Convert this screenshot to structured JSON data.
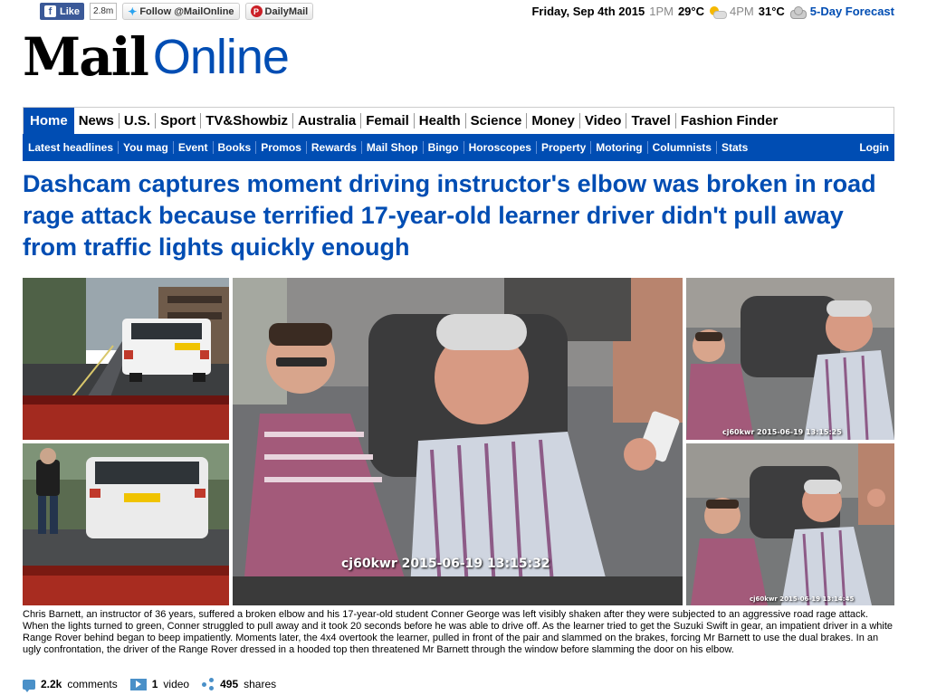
{
  "social": {
    "facebook_label": "Like",
    "facebook_count": "2.8m",
    "twitter_label": "Follow @MailOnline",
    "pinterest_label": "DailyMail"
  },
  "weather": {
    "date": "Friday, Sep 4th 2015",
    "time1": "1PM",
    "temp1": "29°C",
    "time2": "4PM",
    "temp2": "31°C",
    "forecast_link": "5-Day Forecast",
    "icon1": "sun-cloud-icon",
    "icon2": "cloud-icon"
  },
  "logo": {
    "part1": "Mail",
    "part2": "Online"
  },
  "main_nav": [
    "Home",
    "News",
    "U.S.",
    "Sport",
    "TV&Showbiz",
    "Australia",
    "Femail",
    "Health",
    "Science",
    "Money",
    "Video",
    "Travel",
    "Fashion Finder"
  ],
  "sub_nav": [
    "Latest headlines",
    "You mag",
    "Event",
    "Books",
    "Promos",
    "Rewards",
    "Mail Shop",
    "Bingo",
    "Horoscopes",
    "Property",
    "Motoring",
    "Columnists",
    "Stats"
  ],
  "login_label": "Login",
  "article": {
    "headline": "Dashcam captures moment driving instructor's elbow was broken in road rage attack because terrified 17-year-old learner driver didn't pull away from traffic lights quickly enough",
    "caption": "Chris Barnett, an instructor of 36 years, suffered a broken elbow and his 17-year-old student Conner George was left visibly shaken after they were subjected to an aggressive road rage attack. When the lights turned to green, Conner struggled to pull away and it took 20 seconds before he was able to drive off. As the learner tried to get the Suzuki Swift in gear, an impatient driver in a white Range Rover behind began to beep impatiently. Moments later, the 4x4 overtook the learner, pulled in front of the pair and slammed on the brakes, forcing Mr Barnett to use the dual brakes. In an ugly confrontation, the driver of the Range Rover dressed in a hooded top then threatened Mr Barnett through the window before slamming the door on his elbow.",
    "comments_count": "2.2k",
    "comments_label": "comments",
    "video_count": "1",
    "video_label": "video",
    "shares_count": "495",
    "shares_label": "shares",
    "main_timestamp": "cj60kwr 2015-06-19 13:15:32",
    "small_timestamp_1": "cj60kwr 2015-06-19 13:15:25",
    "small_timestamp_2": "cj60kwr 2015-06-19 13:14:45"
  },
  "colors": {
    "brand_blue": "#004db3",
    "facebook_blue": "#3b5998"
  }
}
